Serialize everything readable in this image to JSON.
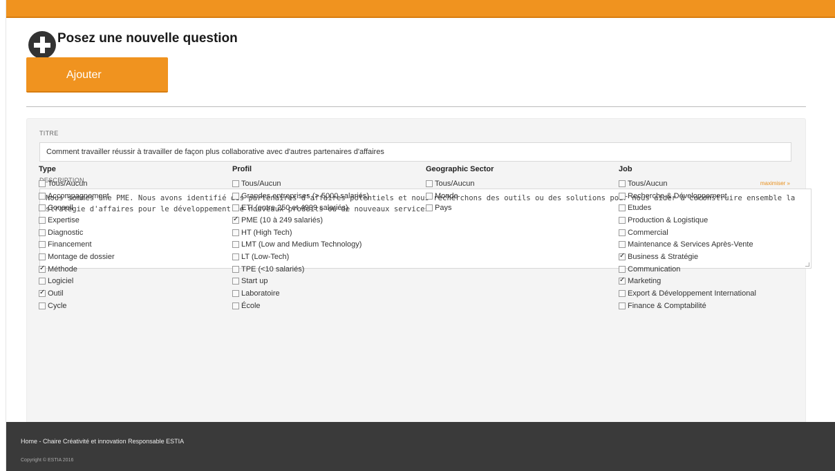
{
  "header": {
    "title": "Posez une nouvelle question",
    "add_button": "Ajouter"
  },
  "form": {
    "title_label": "TITRE",
    "title_value": "Comment travailler réussir à travailler de façon plus collaborative avec d'autres partenaires d'affaires",
    "description_label": "DESCRIPTION",
    "maximize_label": "maximiser »",
    "description_value": "Nous sommes une PME. Nous avons identifié des partenaires d'affaires potentiels et nous recherchons des outils ou des solutions pour nous aider à coconstruire ensemble la stratégie d'affaires pour le développement de nouveaux produits ou de nouveaux services."
  },
  "filters": [
    {
      "title": "Type",
      "options": [
        {
          "label": "Tous/Aucun",
          "checked": false
        },
        {
          "label": "Accompagnement",
          "checked": false
        },
        {
          "label": "Conseil",
          "checked": false
        },
        {
          "label": "Expertise",
          "checked": false
        },
        {
          "label": "Diagnostic",
          "checked": false
        },
        {
          "label": "Financement",
          "checked": false
        },
        {
          "label": "Montage de dossier",
          "checked": false
        },
        {
          "label": "Méthode",
          "checked": true
        },
        {
          "label": "Logiciel",
          "checked": false
        },
        {
          "label": "Outil",
          "checked": true
        },
        {
          "label": "Cycle",
          "checked": false
        }
      ]
    },
    {
      "title": "Profil",
      "options": [
        {
          "label": "Tous/Aucun",
          "checked": false
        },
        {
          "label": "Grandes entreprises (> 5000 salariés)",
          "checked": false
        },
        {
          "label": "ETI (entre 250 et 4999 salariés)",
          "checked": false
        },
        {
          "label": "PME (10 à 249 salariés)",
          "checked": true
        },
        {
          "label": "HT (High Tech)",
          "checked": false
        },
        {
          "label": "LMT (Low and Medium Technology)",
          "checked": false
        },
        {
          "label": "LT (Low-Tech)",
          "checked": false
        },
        {
          "label": "TPE (<10 salariés)",
          "checked": false
        },
        {
          "label": "Start up",
          "checked": false
        },
        {
          "label": "Laboratoire",
          "checked": false
        },
        {
          "label": "École",
          "checked": false
        }
      ]
    },
    {
      "title": "Geographic Sector",
      "options": [
        {
          "label": "Tous/Aucun",
          "checked": false
        },
        {
          "label": "Monde",
          "checked": false
        },
        {
          "label": "Pays",
          "checked": false
        }
      ]
    },
    {
      "title": "Job",
      "options": [
        {
          "label": "Tous/Aucun",
          "checked": false
        },
        {
          "label": "Recherche & Développement",
          "checked": false
        },
        {
          "label": "Etudes",
          "checked": false
        },
        {
          "label": "Production & Logistique",
          "checked": false
        },
        {
          "label": "Commercial",
          "checked": false
        },
        {
          "label": "Maintenance & Services Après-Vente",
          "checked": false
        },
        {
          "label": "Business & Stratégie",
          "checked": true
        },
        {
          "label": "Communication",
          "checked": false
        },
        {
          "label": "Marketing",
          "checked": true
        },
        {
          "label": "Export & Développement International",
          "checked": false
        },
        {
          "label": "Finance & Comptabilité",
          "checked": false
        }
      ]
    }
  ],
  "footer": {
    "nav_text": "Home  -  Chaire Créativité et innovation Responsable ESTIA",
    "copyright": "Copyright © ESTIA 2016"
  }
}
